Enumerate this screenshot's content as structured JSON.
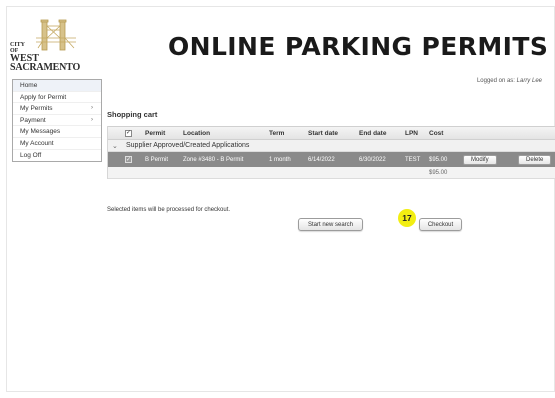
{
  "logo": {
    "line1": "CITY",
    "line2": "OF",
    "line3": "WEST",
    "line4": "SACRAMENTO"
  },
  "header": {
    "title": "ONLINE PARKING PERMITS",
    "logged_prefix": "Logged on as: ",
    "logged_user": "Larry Lee"
  },
  "menu": {
    "items": [
      {
        "label": "Home"
      },
      {
        "label": "Apply for Permit"
      },
      {
        "label": "My Permits",
        "arrow": "›"
      },
      {
        "label": "Payment",
        "arrow": "›"
      },
      {
        "label": "My Messages"
      },
      {
        "label": "My Account"
      },
      {
        "label": "Log Off"
      }
    ]
  },
  "cart": {
    "heading": "Shopping cart",
    "columns": {
      "permit": "Permit",
      "location": "Location",
      "term": "Term",
      "start_date": "Start date",
      "end_date": "End date",
      "lpn": "LPN",
      "cost": "Cost"
    },
    "header_check": "✓",
    "group": {
      "toggle": "⌄",
      "label": "Supplier Approved/Created Applications"
    },
    "rows": [
      {
        "check": "✓",
        "permit": "B Permit",
        "location": "Zone #3480 - B Permit",
        "term": "1 month",
        "start_date": "6/14/2022",
        "end_date": "6/30/2022",
        "lpn": "TEST",
        "cost": "$95.00",
        "modify_label": "Modify",
        "delete_label": "Delete"
      }
    ],
    "total": "$95.00"
  },
  "note": "Selected items will be processed for checkout.",
  "buttons": {
    "start_new_search": "Start new search",
    "checkout": "Checkout"
  },
  "step_badge": "17",
  "colors": {
    "selected_row": "#8a8a8a",
    "badge": "#f2ee12"
  }
}
